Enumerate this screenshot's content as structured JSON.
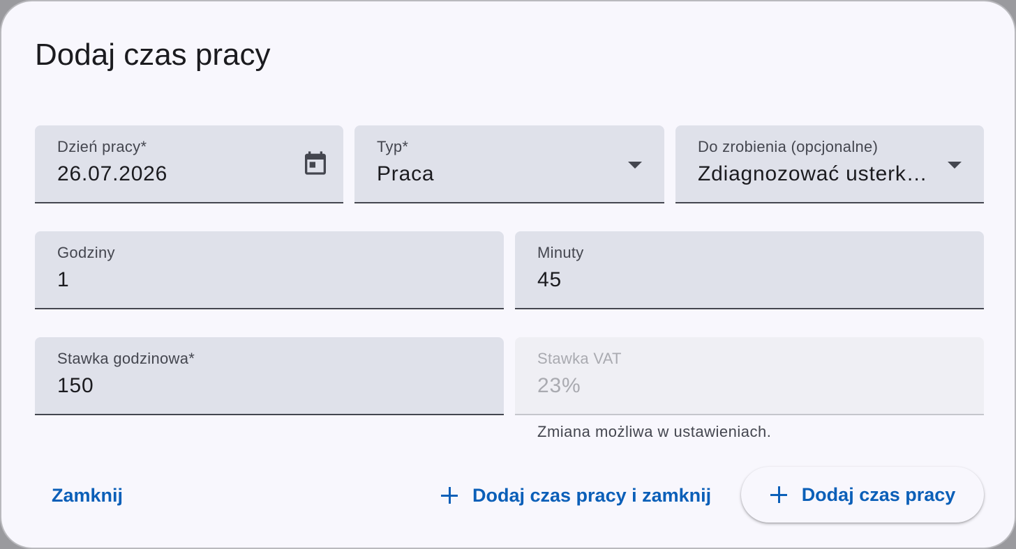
{
  "dialog": {
    "title": "Dodaj czas pracy"
  },
  "fields": {
    "work_day": {
      "label": "Dzień pracy*",
      "value": "26.07.2026",
      "icon": "calendar-icon"
    },
    "type": {
      "label": "Typ*",
      "value": "Praca",
      "icon": "dropdown-arrow-icon"
    },
    "todo": {
      "label": "Do zrobienia (opcjonalne)",
      "value": "Zdiagnozować usterk…",
      "icon": "dropdown-arrow-icon"
    },
    "hours": {
      "label": "Godziny",
      "value": "1"
    },
    "minutes": {
      "label": "Minuty",
      "value": "45"
    },
    "hourly_rate": {
      "label": "Stawka godzinowa*",
      "value": "150"
    },
    "vat_rate": {
      "label": "Stawka VAT",
      "value": "23%",
      "helper": "Zmiana możliwa w ustawieniach.",
      "disabled": true
    }
  },
  "actions": {
    "close_label": "Zamknij",
    "add_and_close_label": "Dodaj czas pracy i zamknij",
    "add_label": "Dodaj czas pracy",
    "add_icon": "plus-icon"
  },
  "colors": {
    "accent": "#0b5fb8",
    "field_bg": "#dfe1ea",
    "surface": "#f8f7fd"
  }
}
